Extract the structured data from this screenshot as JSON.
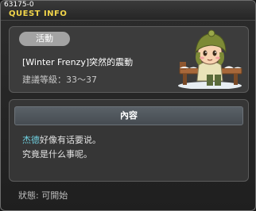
{
  "window": {
    "quest_code": "63175-0",
    "title": "QUEST INFO"
  },
  "quest": {
    "category_badge": "活動",
    "name": "[Winter Frenzy]突然的震動",
    "recommended_level": "建議等級：33～37"
  },
  "content": {
    "header": "內容",
    "npc_name": "杰德",
    "line1_rest": "好像有话要说。",
    "line2": "究竟是什么事呢。"
  },
  "status": {
    "text": "狀態: 可開始"
  },
  "icons": {
    "npc_portrait": "npc-portrait-icon"
  },
  "colors": {
    "title": "#f2d54a",
    "npc_link": "#6fd0e0",
    "badge": "#a3a3a3"
  }
}
